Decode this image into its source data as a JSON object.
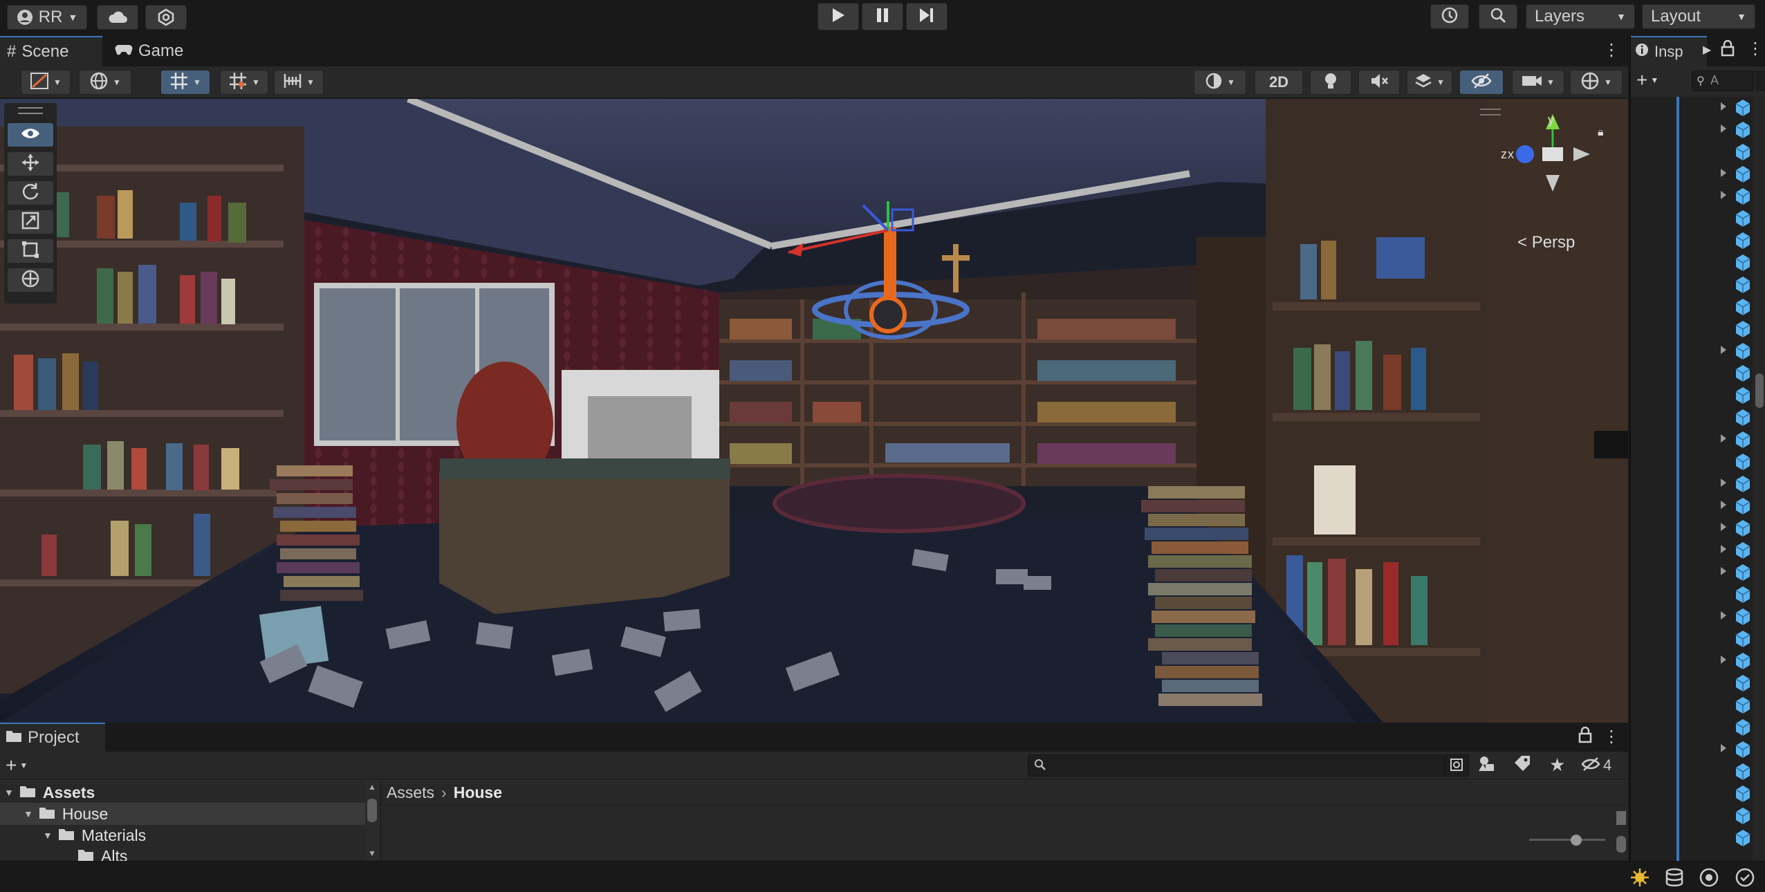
{
  "topbar": {
    "account_label": "RR",
    "layers_label": "Layers",
    "layout_label": "Layout"
  },
  "scene_tabs": [
    {
      "label": "Scene",
      "icon": "grid-hash-icon"
    },
    {
      "label": "Game",
      "icon": "gamepad-icon"
    }
  ],
  "inspector_tab": {
    "label": "Insp",
    "icon": "info-icon"
  },
  "scene_toolbar": {
    "mode_2d_label": "2D"
  },
  "viewport": {
    "projection_label": "Persp",
    "gizmo_axes": {
      "y": "y",
      "z": "z",
      "x": "x"
    }
  },
  "project": {
    "tab_label": "Project",
    "search_placeholder": "",
    "hidden_count": "4",
    "breadcrumb": [
      "Assets",
      "House"
    ],
    "tree": [
      {
        "label": "Assets",
        "bold": true,
        "depth": 0
      },
      {
        "label": "House",
        "bold": false,
        "depth": 1
      },
      {
        "label": "Materials",
        "bold": false,
        "depth": 2
      },
      {
        "label": "Alts",
        "bold": false,
        "depth": 3
      }
    ]
  },
  "right_search_placeholder": "A",
  "colors": {
    "accent": "#3a79bb",
    "panel": "#282828",
    "toolbar_bg": "#191919",
    "selected_tool": "#46607c",
    "cube_blue": "#5ab4f0"
  }
}
